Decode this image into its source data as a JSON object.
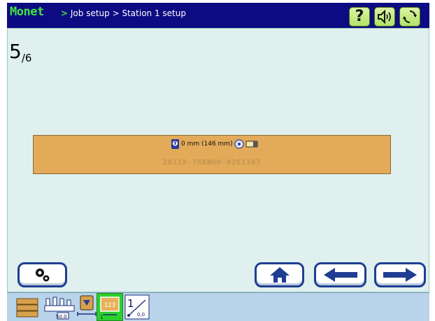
{
  "header": {
    "brand": "Monet",
    "breadcrumb": [
      ">",
      "Job setup",
      ">",
      "Station 1 setup"
    ],
    "help_label": "?"
  },
  "page": {
    "current": "5",
    "total": "/6"
  },
  "message": {
    "distance": "0 mm (146 mm)",
    "code": "20119-7KKWOH-0251107"
  },
  "bottombar": {
    "scale_value": "50.0",
    "step_value": "1",
    "origin_value": "0,0",
    "digits_preview": "123",
    "ratio_value": "1"
  },
  "colors": {
    "title_bg": "#0d0b82",
    "brand": "#3fe23f",
    "content_bg": "#dff0ee",
    "strip": "#e2aa59",
    "nav_blue": "#1f3e93",
    "bottom_bg": "#b9d3ea",
    "active_tile": "#2ccf2c"
  },
  "icons": [
    "help-icon",
    "speaker-icon",
    "refresh-icon",
    "gears-icon",
    "home-icon",
    "arrow-left-icon",
    "arrow-right-icon"
  ]
}
